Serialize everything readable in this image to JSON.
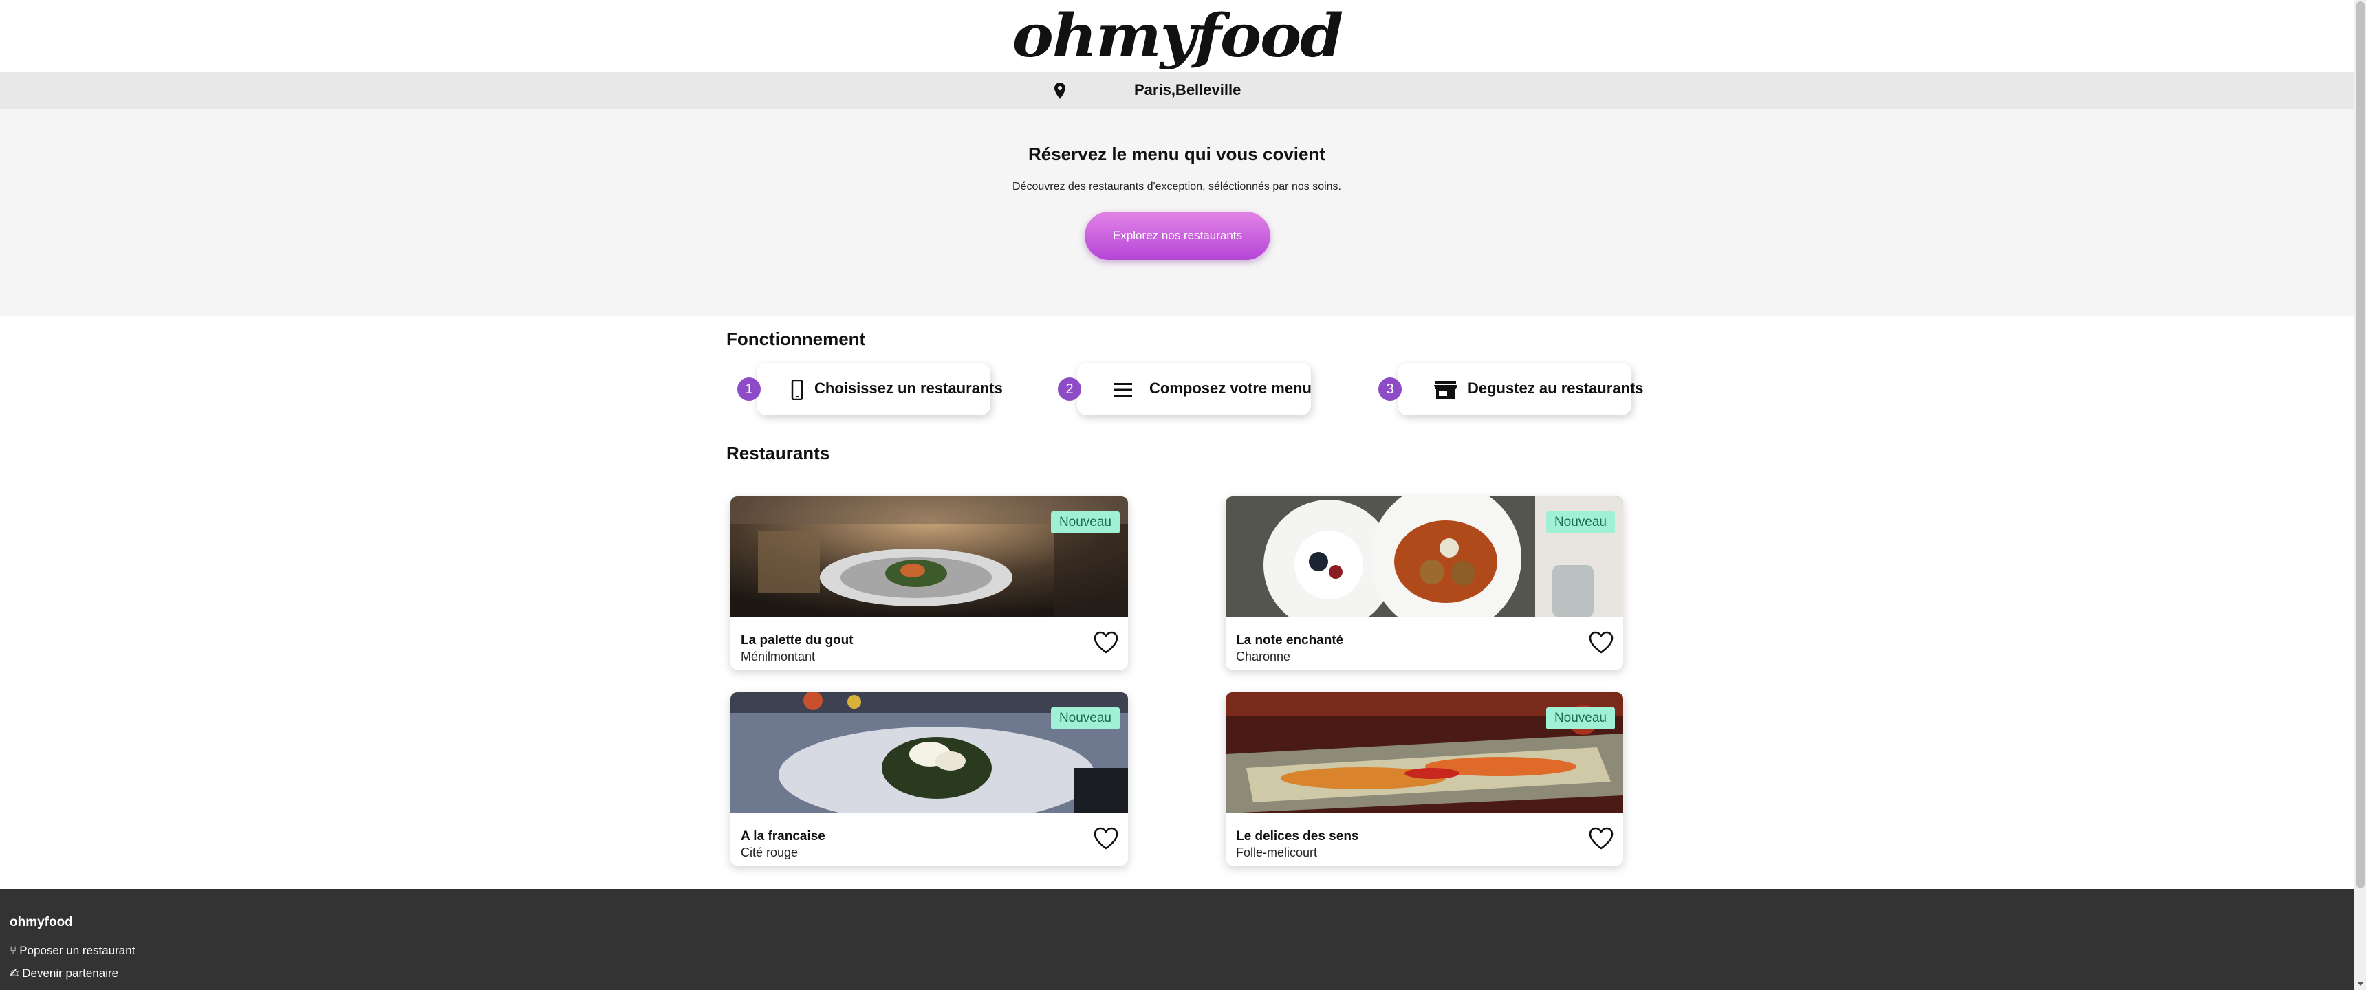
{
  "header": {
    "logo": "ohmyfood"
  },
  "location": {
    "text": "Paris,Belleville",
    "icon": "location-pin-icon"
  },
  "hero": {
    "title": "Réservez le menu qui vous covient",
    "subtitle": "Découvrez des restaurants d'exception, séléctionnés par nos soins.",
    "button": "Explorez nos restaurants"
  },
  "how": {
    "title": "Fonctionnement",
    "steps": [
      {
        "num": "1",
        "label": "Choisissez un restaurants",
        "icon": "smartphone-icon"
      },
      {
        "num": "2",
        "label": "Composez votre menu",
        "icon": "list-icon"
      },
      {
        "num": "3",
        "label": "Degustez au restaurants",
        "icon": "store-icon"
      }
    ]
  },
  "restaurants": {
    "title": "Restaurants",
    "items": [
      {
        "name": "La palette du gout",
        "area": "Ménilmontant",
        "badge": "Nouveau"
      },
      {
        "name": "La note enchanté",
        "area": "Charonne",
        "badge": "Nouveau"
      },
      {
        "name": "A la francaise",
        "area": "Cité rouge",
        "badge": "Nouveau"
      },
      {
        "name": "Le delices des sens",
        "area": "Folle-melicourt",
        "badge": "Nouveau"
      }
    ]
  },
  "footer": {
    "brand": "ohmyfood",
    "links": [
      {
        "label": "Poposer un restaurant",
        "icon": "utensils-icon"
      },
      {
        "label": "Devenir partenaire",
        "icon": "handshake-icon"
      }
    ]
  },
  "colors": {
    "accent": "#8e4bc6",
    "button_gradient_top": "#e283e6",
    "button_gradient_bottom": "#b545d6",
    "badge_bg": "#9ff0d4",
    "footer_bg": "#333333"
  }
}
